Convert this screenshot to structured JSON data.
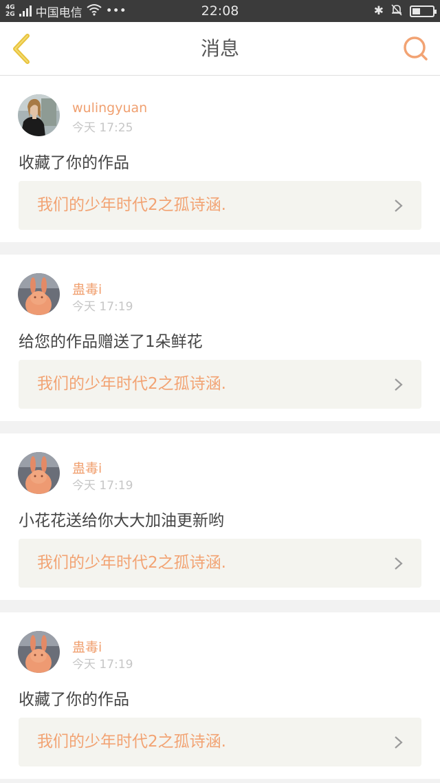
{
  "status_bar": {
    "network_top": "4G",
    "network_bottom": "2G",
    "carrier": "中国电信",
    "more": "•••",
    "time": "22:08",
    "bluetooth": "✱",
    "battery_level": 0.4,
    "colors": {
      "bg": "#3b3b3b",
      "fg": "#e8e8e8"
    }
  },
  "header": {
    "title": "消息",
    "back_icon": "chevron-left-icon",
    "search_icon": "search-icon",
    "colors": {
      "back": "#e8c23c",
      "search": "#f2a373"
    }
  },
  "messages": [
    {
      "username": "wulingyuan",
      "time": "今天  17:25",
      "action": "收藏了你的作品",
      "work_title": "我们的少年时代2之孤诗涵.",
      "avatar": "portrait-avatar"
    },
    {
      "username": "蛊毒i",
      "time": "今天  17:19",
      "action": "给您的作品赠送了1朵鲜花",
      "work_title": "我们的少年时代2之孤诗涵.",
      "avatar": "rabbit-avatar"
    },
    {
      "username": "蛊毒i",
      "time": "今天  17:19",
      "action": "小花花送给你大大加油更新哟",
      "work_title": "我们的少年时代2之孤诗涵.",
      "avatar": "rabbit-avatar"
    },
    {
      "username": "蛊毒i",
      "time": "今天  17:19",
      "action": "收藏了你的作品",
      "work_title": "我们的少年时代2之孤诗涵.",
      "avatar": "rabbit-avatar"
    }
  ],
  "colors": {
    "accent": "#f2a373",
    "username": "#f0a070",
    "link_bg": "#f4f4ef",
    "page_bg": "#f2f2f2"
  }
}
